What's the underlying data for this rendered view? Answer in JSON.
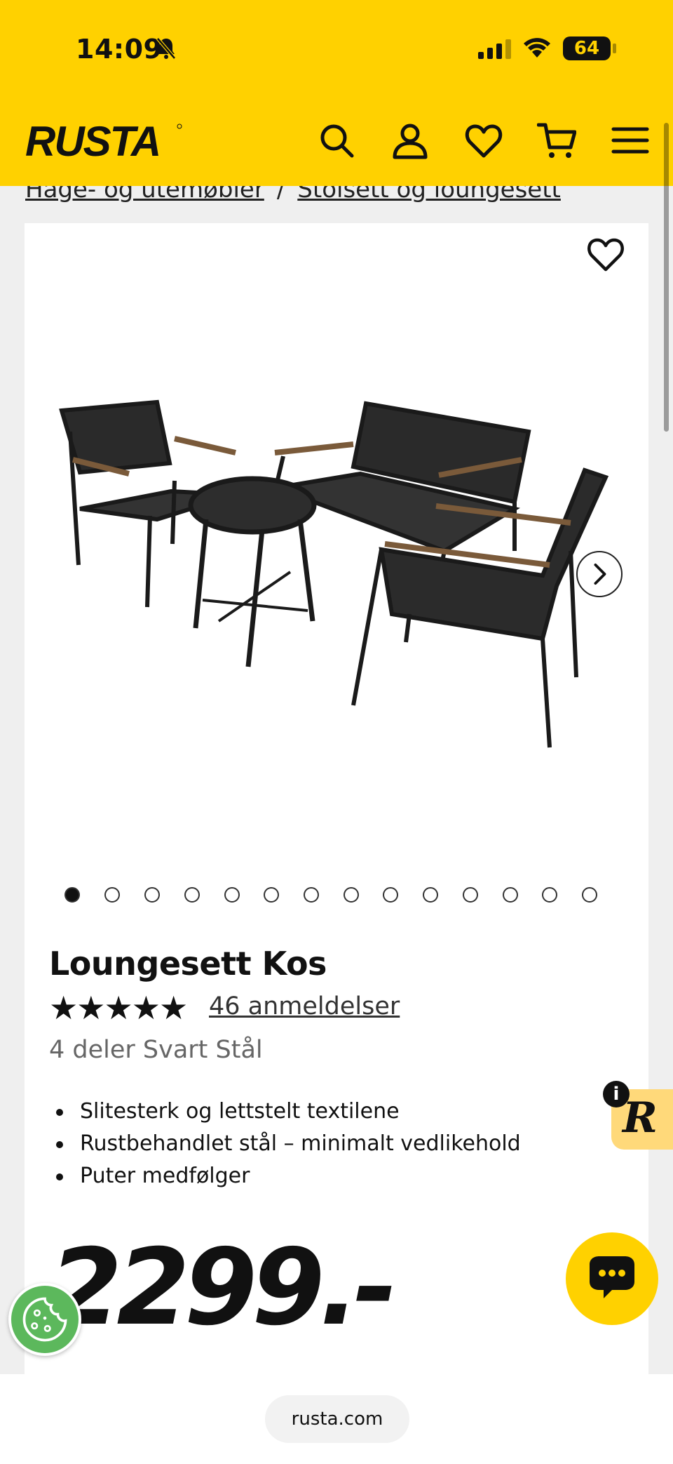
{
  "status_bar": {
    "time": "14:09",
    "battery": "64"
  },
  "header": {
    "logo_text": "RUSTA",
    "brand_color": "#ffd100",
    "icons": [
      "search-icon",
      "user-icon",
      "heart-icon",
      "cart-icon",
      "menu-icon"
    ]
  },
  "breadcrumb": {
    "items": [
      "Hage- og utemøbler",
      "Stolsett og loungesett"
    ],
    "separator": "/"
  },
  "gallery": {
    "image_count": 14,
    "active_index": 0
  },
  "product": {
    "title": "Loungesett Kos",
    "stars": "★★★★★",
    "rating": 5,
    "reviews_label": "46 anmeldelser",
    "variant": "4 deler Svart Stål",
    "features": [
      "Slitesterk og lettstelt textilene",
      "Rustbehandlet stål – minimalt vedlikehold",
      "Puter medfølger"
    ],
    "price": "2299.-"
  },
  "widgets": {
    "info_label": "i",
    "r_badge": "R"
  },
  "browser": {
    "url": "rusta.com"
  }
}
